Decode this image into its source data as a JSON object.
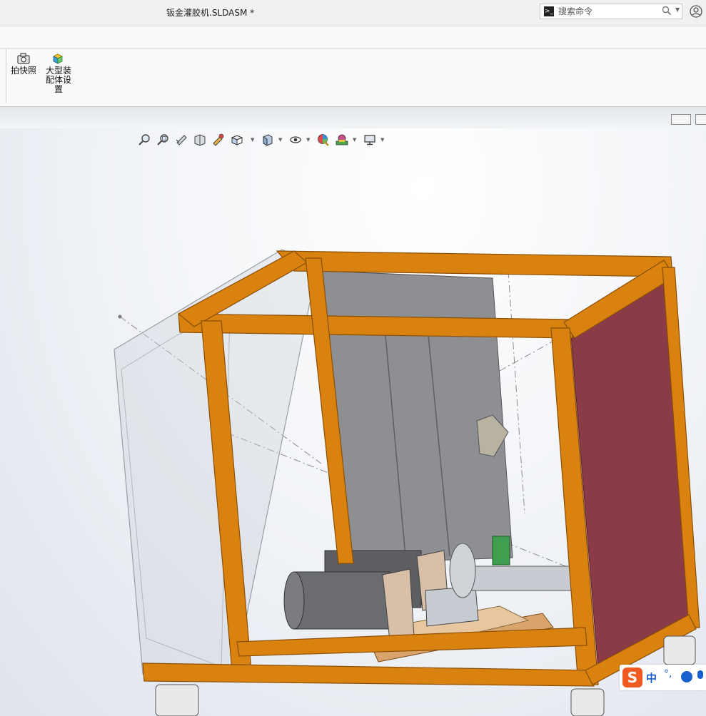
{
  "window": {
    "title": "钣金灌胶机.SLDASM *"
  },
  "search": {
    "placeholder": "搜索命令"
  },
  "ribbon": {
    "buttons": [
      {
        "label": "拍快照",
        "icon": "camera-icon"
      },
      {
        "label": "大型装配体设置",
        "icon": "large-assembly-icon"
      }
    ]
  },
  "view_toolbar": {
    "icons": [
      "zoom-to-fit-icon",
      "zoom-to-area-icon",
      "previous-view-icon",
      "section-view-icon",
      "dynamic-annotation-icon",
      "view-orientation-icon",
      "display-style-icon",
      "hide-show-items-icon",
      "edit-appearance-icon",
      "apply-scene-icon",
      "view-settings-icon"
    ]
  },
  "ime": {
    "lang": "中",
    "brand": "S"
  },
  "colors": {
    "frame": "#d9820f",
    "frame_dark": "#9a5a08",
    "panel_red": "#8b3a48",
    "panel_gray": "#8a8c90",
    "base_plate": "#e6b07a"
  }
}
